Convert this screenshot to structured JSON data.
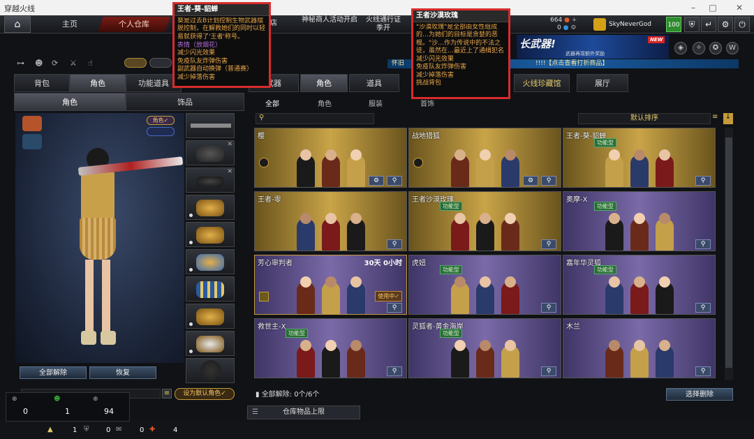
{
  "window": {
    "title": "穿越火线",
    "min": "–",
    "max": "□",
    "close": "✕"
  },
  "nav": {
    "home_icon": "home-icon",
    "items": [
      "主页",
      "个人仓库"
    ],
    "partial_store": "店",
    "mid1": "神秘商人活动开启",
    "mid2": "火线通行证季开",
    "mid2b": "季开"
  },
  "header": {
    "currency_1": "664",
    "currency_2": "0",
    "username": "SkyNeverGod",
    "level": "100"
  },
  "banner": {
    "text": "长武器!",
    "sub": "武器再现额外奖励",
    "new": "NEW"
  },
  "marquee": {
    "left": "怀旧",
    "right": "!!!!【点击查看打折商品】"
  },
  "left": {
    "main_tabs": [
      "背包",
      "角色",
      "功能道具"
    ],
    "sub_tabs": [
      "角色",
      "饰品"
    ],
    "role_toggle": "角色✓",
    "unequip_all": "全部解除",
    "restore": "恢复",
    "set_default": "设为默认角色✓",
    "stats": {
      "a": "0",
      "b": "1",
      "c": "94"
    }
  },
  "right": {
    "cat_tabs": [
      "武器",
      "角色",
      "道具",
      "火线珍藏馆",
      "展厅"
    ],
    "sub_tabs": [
      "全部",
      "角色",
      "服装",
      "首饰"
    ],
    "sort_label": "默认排序",
    "footer_info": "全部解除: 0个/6个",
    "clear_button": "选择删除",
    "limit_button": "仓库物品上限"
  },
  "cards": [
    {
      "name": "樱",
      "tier": "gold",
      "badge": ""
    },
    {
      "name": "战地猎狐",
      "tier": "gold",
      "badge": ""
    },
    {
      "name": "王者-葵-貂蝉",
      "tier": "gold",
      "badge": "功能型"
    },
    {
      "name": "王者-零",
      "tier": "gold",
      "badge": ""
    },
    {
      "name": "王者沙漠玫瑰",
      "tier": "gold",
      "badge": "功能型"
    },
    {
      "name": "奥摩-X",
      "tier": "purple",
      "badge": "功能型"
    },
    {
      "name": "芳心审判者",
      "tier": "purple",
      "badge": "",
      "time": "30天 0小时",
      "inuse": "使用中✓"
    },
    {
      "name": "虎妞",
      "tier": "purple",
      "badge": "功能型"
    },
    {
      "name": "嘉年华灵狐",
      "tier": "purple",
      "badge": "功能型"
    },
    {
      "name": "救世主-X",
      "tier": "purple",
      "badge": "功能型"
    },
    {
      "name": "灵狐者-黄金海岸",
      "tier": "purple",
      "badge": "功能型"
    },
    {
      "name": "木兰",
      "tier": "purple",
      "badge": ""
    }
  ],
  "popup1": {
    "title": "王者-葵-貂蝉",
    "desc": "葵是过去B计划控制生物武器摆脱控制，在解救她们的同时以轻易就获得了'王者'称号。",
    "l1": "表情（放烟花）",
    "l2": "减少闪光效果",
    "l3": "免疫队友炸弹伤害",
    "l4": "副武器自动换弹（普通赛）",
    "l5": "减少掉落伤害"
  },
  "popup2": {
    "title": "王者沙漠玫瑰",
    "desc": "\"沙漠玫瑰\"是全部由女性组成的…为她们的目标是贪婪的恶棍。\"沙…作为传说中的不法之徒，虽然在…最近上了通缉犯名单榜首的人还…",
    "l1": "减少闪光效果",
    "l2": "免疫队友炸弹伤害",
    "l3": "减少掉落伤害",
    "l4": "挑战背包"
  },
  "bottom": {
    "v1": "1",
    "v2": "0",
    "v3": "0",
    "v4": "4"
  }
}
